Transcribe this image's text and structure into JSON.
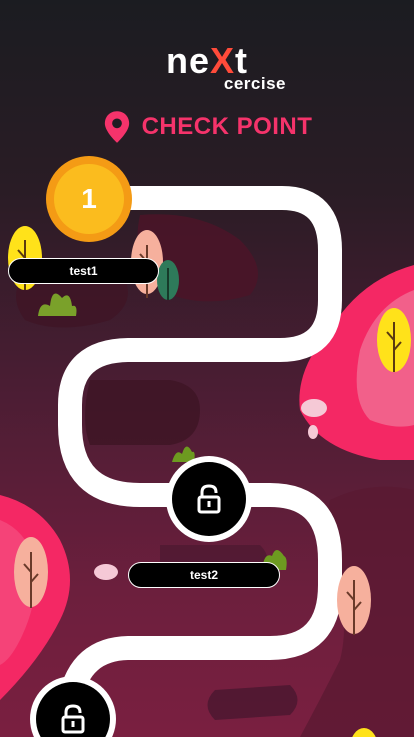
{
  "brand": {
    "logo_text_ne": "ne",
    "logo_text_x": "X",
    "logo_text_t": "t",
    "logo_subtext": "cercise",
    "accent_color": "#f5336b"
  },
  "header": {
    "title": "CHECK POINT",
    "icon": "location-pin-icon"
  },
  "checkpoints": [
    {
      "number": "1",
      "label": "test1",
      "state": "current"
    },
    {
      "label": "test2",
      "state": "locked",
      "icon": "lock-icon"
    },
    {
      "state": "locked",
      "icon": "lock-icon"
    }
  ]
}
